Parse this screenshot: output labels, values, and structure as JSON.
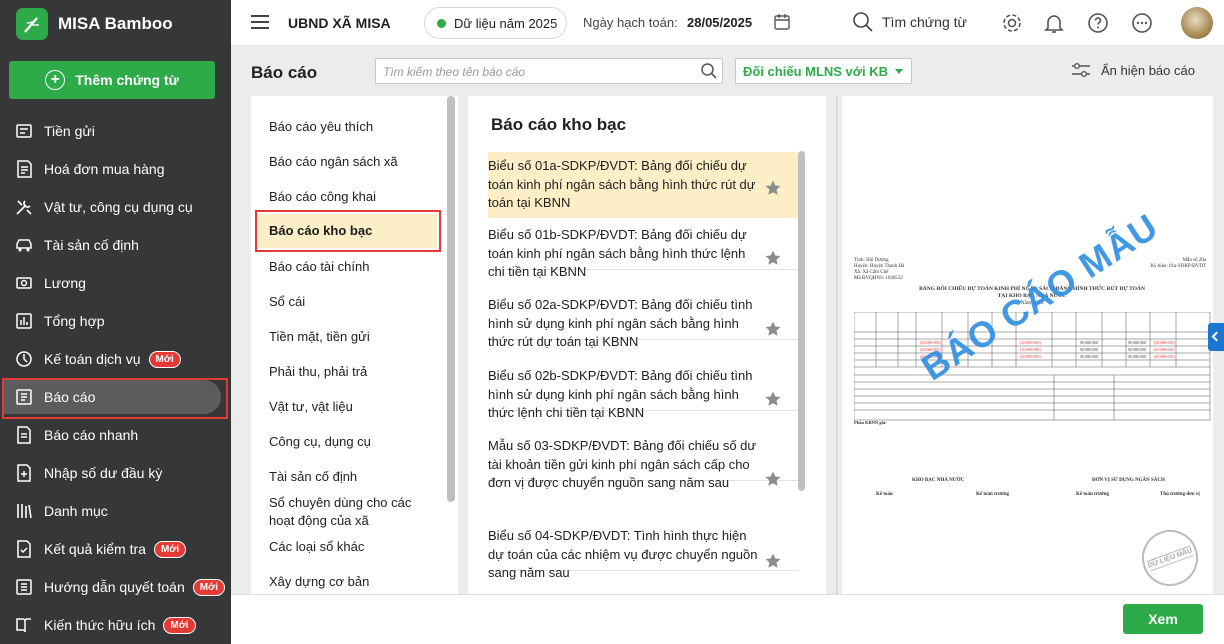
{
  "app": {
    "name": "MISA Bamboo"
  },
  "sidebar": {
    "add_button": "Thêm chứng từ",
    "items": [
      {
        "label": "Tiền gửi",
        "badge": ""
      },
      {
        "label": "Hoá đơn mua hàng",
        "badge": ""
      },
      {
        "label": "Vật tư, công cụ dụng cụ",
        "badge": ""
      },
      {
        "label": "Tài sản cố định",
        "badge": ""
      },
      {
        "label": "Lương",
        "badge": ""
      },
      {
        "label": "Tổng hợp",
        "badge": ""
      },
      {
        "label": "Kế toán dịch vụ",
        "badge": "Mới"
      },
      {
        "label": "Báo cáo",
        "badge": ""
      },
      {
        "label": "Báo cáo nhanh",
        "badge": ""
      },
      {
        "label": "Nhập số dư đầu kỳ",
        "badge": ""
      },
      {
        "label": "Danh mục",
        "badge": ""
      },
      {
        "label": "Kết quả kiểm tra",
        "badge": "Mới"
      },
      {
        "label": "Hướng dẫn quyết toán",
        "badge": "Mới"
      },
      {
        "label": "Kiến thức hữu ích",
        "badge": "Mới"
      }
    ]
  },
  "topbar": {
    "org": "UBND XÃ MISA",
    "year_chip": "Dữ liệu năm 2025",
    "date_label": "Ngày hạch toán:",
    "date_value": "28/05/2025",
    "search_label": "Tìm chứng từ"
  },
  "reports": {
    "title": "Báo cáo",
    "search_placeholder": "Tìm kiếm theo tên báo cáo",
    "filter_value": "Đối chiếu MLNS với KB",
    "toggle_label": "Ẩn hiện báo cáo",
    "categories": [
      "Báo cáo yêu thích",
      "Báo cáo ngân sách xã",
      "Báo cáo công khai",
      "Báo cáo kho bạc",
      "Báo cáo tài chính",
      "Sổ cái",
      "Tiền mặt, tiền gửi",
      "Phải thu, phải trả",
      "Vật tư, vật liệu",
      "Công cụ, dụng cụ",
      "Tài sản cố định",
      "Sổ chuyên dùng cho các hoạt động của xã",
      "Các loại sổ khác",
      "Xây dựng cơ bản"
    ],
    "list_title": "Báo cáo kho bạc",
    "items": [
      "Biểu số 01a-SDKP/ĐVDT: Bảng đối chiếu dự toán kinh phí ngân sách bằng hình thức rút dự toán tại KBNN",
      "Biểu số 01b-SDKP/ĐVDT: Bảng đối chiếu dự toán kinh phí ngân sách bằng hình thức lệnh chi tiền tại KBNN",
      "Biểu số 02a-SDKP/ĐVDT: Bảng đối chiếu tình hình sử dụng kinh phí ngân sách bằng hình thức rút dự toán tại KBNN",
      "Biểu số 02b-SDKP/ĐVDT: Bảng đối chiếu tình hình sử dụng kinh phí ngân sách bằng hình thức lệnh chi tiền tại KBNN",
      "Mẫu số 03-SDKP/ĐVDT: Bảng đối chiếu số dư tài khoản tiền gửi kinh phí ngân sách cấp cho đơn vị được chuyển nguồn sang năm sau",
      "Biểu số 04-SDKP/ĐVDT: Tình hình thực hiện dự toán của các nhiệm vụ được chuyển nguồn sang năm sau"
    ]
  },
  "preview": {
    "header_left": [
      "Tỉnh: Hải Dương",
      "Huyện: Huyện Thanh Hà",
      "Xã: Xã Cẩm Chế",
      "Mã ĐVQHNS: 1020532"
    ],
    "header_right": [
      "Mẫu số 20a",
      "Ký hiệu: 01a-SDKP/ĐVDT"
    ],
    "doc_title_1": "BẢNG ĐỐI CHIẾU DỰ TOÁN KINH PHÍ NGÂN SÁCH BẰNG HÌNH THỨC RÚT DỰ TOÁN",
    "doc_title_2": "TẠI KHO BẠC NHÀ NƯỚC",
    "doc_year": "Năm 2023",
    "table_header": [
      "Mã nguồn NSNN",
      "Mã ngành kinh tế",
      "Mã CTMT, DA",
      "DT năm trước chuyển sang",
      "Dự toán giao đầu năm",
      "DT năm nay",
      "Tổng số",
      "Lũy kế đến kỳ báo cáo",
      "DT được sử dụng trong năm",
      "Tổng số",
      "Số do đến kỳ báo cáo",
      "Tổng số",
      "Số do đến kỳ báo cáo",
      "DT giữ lại",
      "DT còn lại"
    ],
    "section_label": "Phần KBNN ghi:",
    "sign_left": "KHO BẠC NHÀ NƯỚC",
    "sign_right": "ĐƠN VỊ SỬ DỤNG NGÂN SÁCH",
    "sign_roles": [
      "Kế toán",
      "Kế toán trưởng",
      "Kế toán trưởng",
      "Thủ trưởng đơn vị"
    ],
    "watermark": "BÁO CÁO MẪU",
    "stamp": "DỮ LIỆU MẪU"
  },
  "footer": {
    "view_button": "Xem"
  },
  "colors": {
    "brand_green": "#2eab49",
    "highlight": "#fcefc7",
    "badge_red": "#e53935",
    "watermark_blue": "#2d8fe0"
  }
}
